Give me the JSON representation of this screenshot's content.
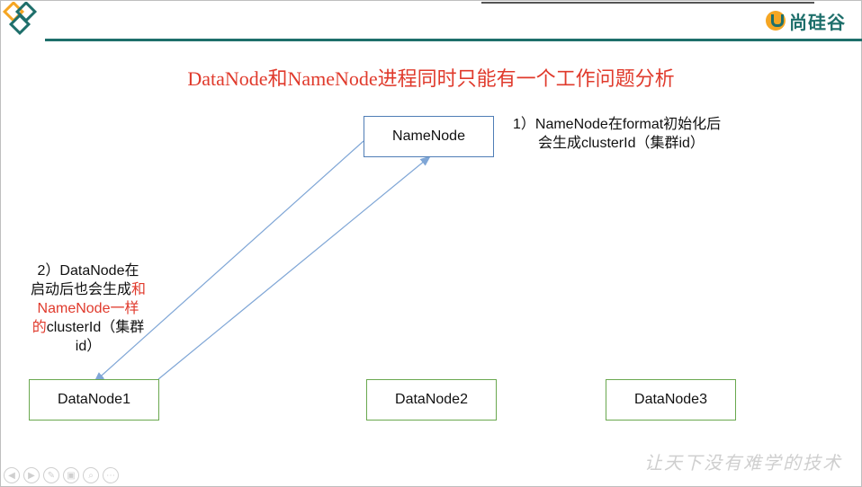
{
  "brand": {
    "name": "尚硅谷"
  },
  "title": "DataNode和NameNode进程同时只能有一个工作问题分析",
  "nodes": {
    "namenode": "NameNode",
    "datanode1": "DataNode1",
    "datanode2": "DataNode2",
    "datanode3": "DataNode3"
  },
  "notes": {
    "note1_line1": "1）NameNode在format初始化后",
    "note1_line2": "会生成clusterId（集群id）",
    "note2_line1": "2）DataNode在",
    "note2_line2_black": "启动后也会生成",
    "note2_line2_red": "和",
    "note2_line3_red": "NameNode一样",
    "note2_line4_red": "的",
    "note2_line4_black": "clusterId（集群",
    "note2_line5": "id）"
  },
  "watermark": "让天下没有难学的技术",
  "colors": {
    "title": "#e03a2c",
    "accent": "#1e6f6b",
    "namenode_border": "#4f7db6",
    "datanode_border": "#6aa84f",
    "arrow": "#7fa6d6"
  },
  "controls": [
    "prev-icon",
    "next-icon",
    "pen-icon",
    "slides-icon",
    "zoom-icon",
    "more-icon"
  ]
}
